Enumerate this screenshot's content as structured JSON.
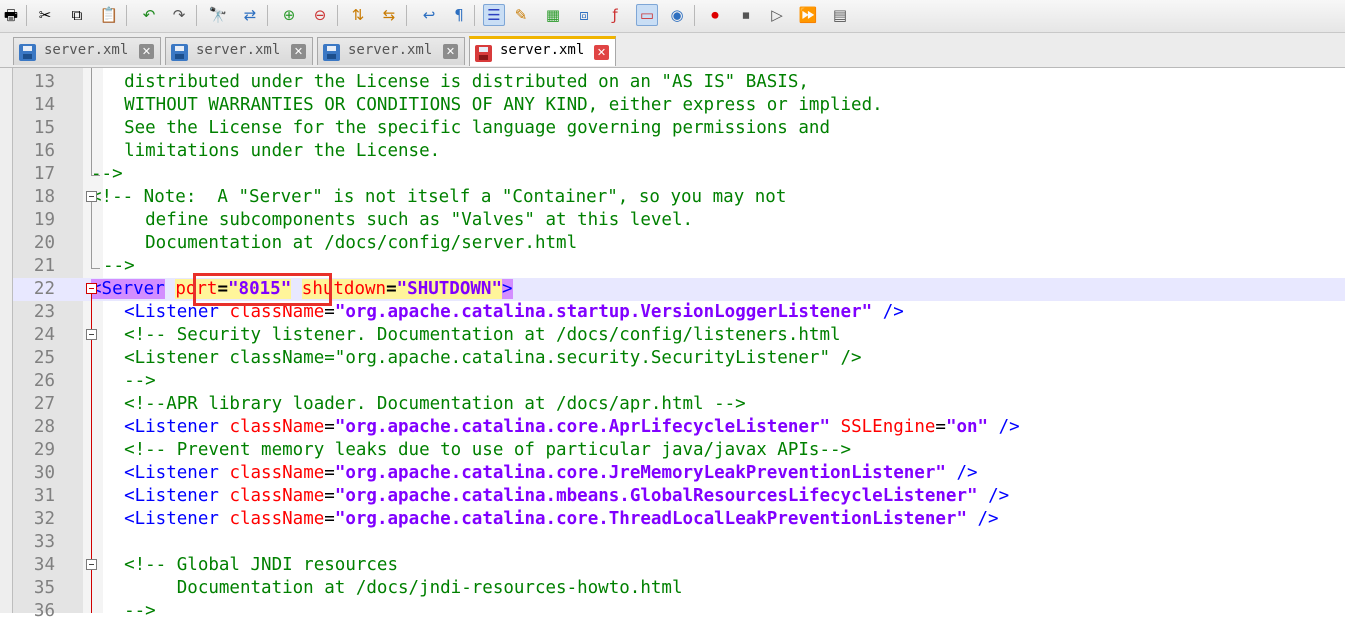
{
  "toolbar": {
    "icons": [
      "print-icon",
      "cut-icon",
      "copy-icon",
      "paste-icon",
      "undo-icon",
      "redo-icon",
      "find-icon",
      "replace-icon",
      "zoom-in-icon",
      "zoom-out-icon",
      "sync-vertical-icon",
      "sync-horizontal-icon",
      "word-wrap-icon",
      "show-all-chars-icon",
      "indent-guide-icon",
      "user-lang-icon",
      "doc-map-icon",
      "function-list-icon",
      "folder-workspace-icon",
      "monitoring-icon",
      "start-record-icon",
      "stop-record-icon",
      "playback-icon",
      "run-macro-multiple-icon",
      "save-macro-icon"
    ]
  },
  "tabs": [
    {
      "label": "server.xml",
      "active": false
    },
    {
      "label": "server.xml",
      "active": false
    },
    {
      "label": "server.xml",
      "active": false
    },
    {
      "label": "server.xml",
      "active": true
    }
  ],
  "editor": {
    "lines": [
      {
        "num": "13",
        "text": "distributed under the License is distributed on an \"AS IS\" BASIS,"
      },
      {
        "num": "14",
        "text": "WITHOUT WARRANTIES OR CONDITIONS OF ANY KIND, either express or implied."
      },
      {
        "num": "15",
        "text": "See the License for the specific language governing permissions and"
      },
      {
        "num": "16",
        "text": "limitations under the License."
      },
      {
        "num": "17",
        "text": "-->"
      },
      {
        "num": "18",
        "text": "<!-- Note:  A \"Server\" is not itself a \"Container\", so you may not"
      },
      {
        "num": "19",
        "text": "define subcomponents such as \"Valves\" at this level."
      },
      {
        "num": "20",
        "text": "Documentation at /docs/config/server.html"
      },
      {
        "num": "21",
        "text": "-->"
      },
      {
        "num": "22",
        "text": "<Server port=\"8015\" shutdown=\"SHUTDOWN\">"
      },
      {
        "num": "23",
        "text": "<Listener className=\"org.apache.catalina.startup.VersionLoggerListener\" />"
      },
      {
        "num": "24",
        "text": "<!-- Security listener. Documentation at /docs/config/listeners.html"
      },
      {
        "num": "25",
        "text": "<Listener className=\"org.apache.catalina.security.SecurityListener\" />"
      },
      {
        "num": "26",
        "text": "-->"
      },
      {
        "num": "27",
        "text": "<!--APR library loader. Documentation at /docs/apr.html -->"
      },
      {
        "num": "28",
        "text": "<Listener className=\"org.apache.catalina.core.AprLifecycleListener\" SSLEngine=\"on\" />"
      },
      {
        "num": "29",
        "text": "<!-- Prevent memory leaks due to use of particular java/javax APIs-->"
      },
      {
        "num": "30",
        "text": "<Listener className=\"org.apache.catalina.core.JreMemoryLeakPreventionListener\" />"
      },
      {
        "num": "31",
        "text": "<Listener className=\"org.apache.catalina.mbeans.GlobalResourcesLifecycleListener\" />"
      },
      {
        "num": "32",
        "text": "<Listener className=\"org.apache.catalina.core.ThreadLocalLeakPreventionListener\" />"
      },
      {
        "num": "33",
        "text": ""
      },
      {
        "num": "34",
        "text": "<!-- Global JNDI resources"
      },
      {
        "num": "35",
        "text": "Documentation at /docs/jndi-resources-howto.html"
      },
      {
        "num": "36",
        "text": "-->"
      }
    ]
  }
}
